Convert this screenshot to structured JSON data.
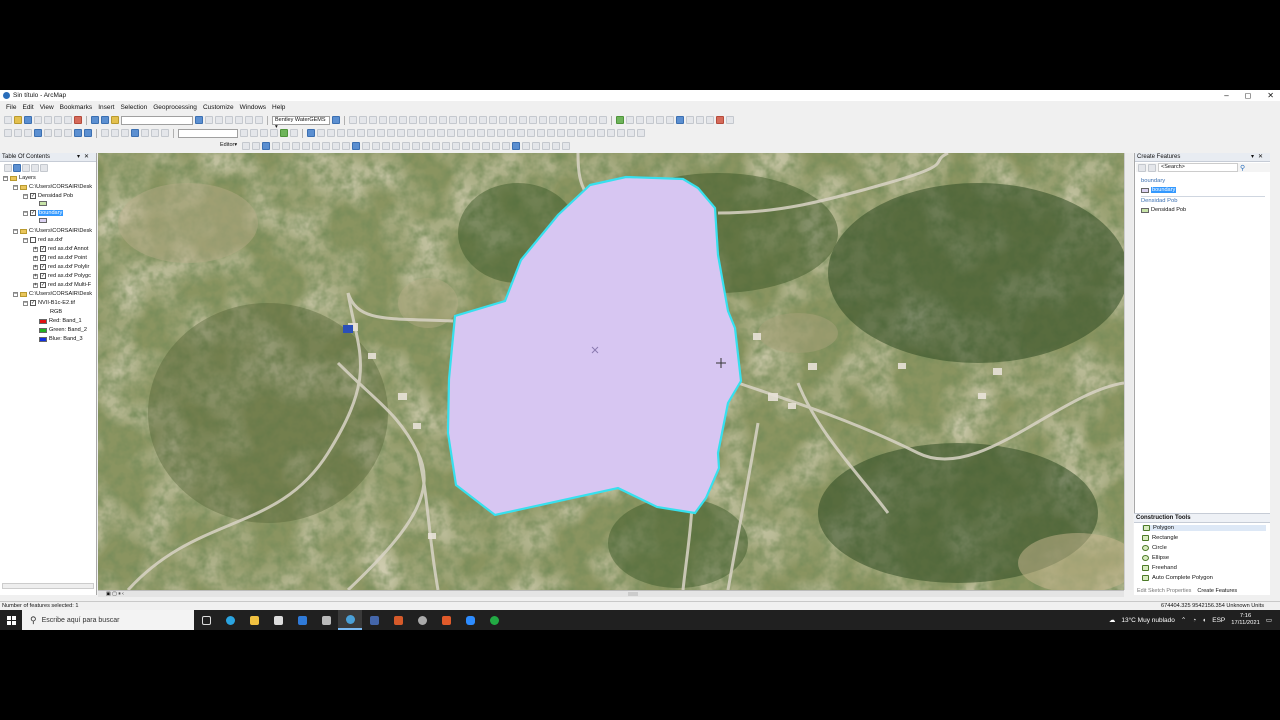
{
  "window": {
    "title": "Sin título - ArcMap",
    "controls": [
      "–",
      "◻",
      "✕"
    ]
  },
  "menu": [
    "File",
    "Edit",
    "View",
    "Bookmarks",
    "Insert",
    "Selection",
    "Geoprocessing",
    "Customize",
    "Windows",
    "Help"
  ],
  "toolbar": {
    "bentley_label": "Bentley WaterGEMS ▾",
    "editor_label": "Editor▾"
  },
  "toc": {
    "title": "Table Of Contents",
    "layers_label": "Layers",
    "rows": [
      {
        "label": "C:\\Users\\CORSAIR\\Desk"
      },
      {
        "label": "Densidad Pob"
      },
      {
        "label": "boundary"
      },
      {
        "label": "C:\\Users\\CORSAIR\\Desk"
      },
      {
        "label": "red as.dxf"
      },
      {
        "label": "red as.dxf Annot"
      },
      {
        "label": "red as.dxf Point"
      },
      {
        "label": "red as.dxf Polylir"
      },
      {
        "label": "red as.dxf Polygc"
      },
      {
        "label": "red as.dxf Multi-F"
      },
      {
        "label": "C:\\Users\\CORSAIR\\Desk"
      },
      {
        "label": "NVII-B1c-E2.tif"
      },
      {
        "label": "RGB"
      },
      {
        "label": "Red:   Band_1"
      },
      {
        "label": "Green: Band_2"
      },
      {
        "label": "Blue:  Band_3"
      }
    ],
    "band_colors": [
      "#e01010",
      "#20b020",
      "#1030e0"
    ]
  },
  "create_features": {
    "title": "Create Features",
    "search_placeholder": "<Search>",
    "groups": [
      {
        "group": "boundary",
        "item": "boundary",
        "selected": true
      },
      {
        "group": "Densidad Pob",
        "item": "Densidad Pob",
        "selected": false
      }
    ]
  },
  "construction_tools": {
    "title": "Construction Tools",
    "items": [
      "Polygon",
      "Rectangle",
      "Circle",
      "Ellipse",
      "Freehand",
      "Auto Complete Polygon"
    ],
    "selected": "Polygon",
    "tabs": [
      "Edit Sketch Properties",
      "Create Features"
    ]
  },
  "status": {
    "selected_features": "Number of features selected: 1",
    "coordinates": "674404.325  9542156.354 Unknown Units"
  },
  "taskbar": {
    "search_placeholder": "Escribe aquí para buscar",
    "weather": "13°C  Muy nublado",
    "language": "ESP",
    "time": "7:16",
    "date": "17/11/2021"
  },
  "map": {
    "polygon_fill": "#d7c6f2",
    "polygon_stroke": "#37e0ee"
  }
}
